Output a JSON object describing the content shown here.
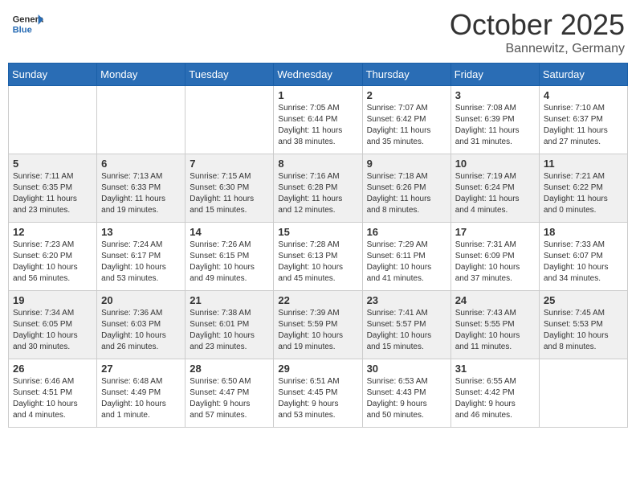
{
  "header": {
    "logo_general": "General",
    "logo_blue": "Blue",
    "month": "October 2025",
    "location": "Bannewitz, Germany"
  },
  "days_of_week": [
    "Sunday",
    "Monday",
    "Tuesday",
    "Wednesday",
    "Thursday",
    "Friday",
    "Saturday"
  ],
  "weeks": [
    [
      {
        "day": "",
        "detail": ""
      },
      {
        "day": "",
        "detail": ""
      },
      {
        "day": "",
        "detail": ""
      },
      {
        "day": "1",
        "detail": "Sunrise: 7:05 AM\nSunset: 6:44 PM\nDaylight: 11 hours\nand 38 minutes."
      },
      {
        "day": "2",
        "detail": "Sunrise: 7:07 AM\nSunset: 6:42 PM\nDaylight: 11 hours\nand 35 minutes."
      },
      {
        "day": "3",
        "detail": "Sunrise: 7:08 AM\nSunset: 6:39 PM\nDaylight: 11 hours\nand 31 minutes."
      },
      {
        "day": "4",
        "detail": "Sunrise: 7:10 AM\nSunset: 6:37 PM\nDaylight: 11 hours\nand 27 minutes."
      }
    ],
    [
      {
        "day": "5",
        "detail": "Sunrise: 7:11 AM\nSunset: 6:35 PM\nDaylight: 11 hours\nand 23 minutes."
      },
      {
        "day": "6",
        "detail": "Sunrise: 7:13 AM\nSunset: 6:33 PM\nDaylight: 11 hours\nand 19 minutes."
      },
      {
        "day": "7",
        "detail": "Sunrise: 7:15 AM\nSunset: 6:30 PM\nDaylight: 11 hours\nand 15 minutes."
      },
      {
        "day": "8",
        "detail": "Sunrise: 7:16 AM\nSunset: 6:28 PM\nDaylight: 11 hours\nand 12 minutes."
      },
      {
        "day": "9",
        "detail": "Sunrise: 7:18 AM\nSunset: 6:26 PM\nDaylight: 11 hours\nand 8 minutes."
      },
      {
        "day": "10",
        "detail": "Sunrise: 7:19 AM\nSunset: 6:24 PM\nDaylight: 11 hours\nand 4 minutes."
      },
      {
        "day": "11",
        "detail": "Sunrise: 7:21 AM\nSunset: 6:22 PM\nDaylight: 11 hours\nand 0 minutes."
      }
    ],
    [
      {
        "day": "12",
        "detail": "Sunrise: 7:23 AM\nSunset: 6:20 PM\nDaylight: 10 hours\nand 56 minutes."
      },
      {
        "day": "13",
        "detail": "Sunrise: 7:24 AM\nSunset: 6:17 PM\nDaylight: 10 hours\nand 53 minutes."
      },
      {
        "day": "14",
        "detail": "Sunrise: 7:26 AM\nSunset: 6:15 PM\nDaylight: 10 hours\nand 49 minutes."
      },
      {
        "day": "15",
        "detail": "Sunrise: 7:28 AM\nSunset: 6:13 PM\nDaylight: 10 hours\nand 45 minutes."
      },
      {
        "day": "16",
        "detail": "Sunrise: 7:29 AM\nSunset: 6:11 PM\nDaylight: 10 hours\nand 41 minutes."
      },
      {
        "day": "17",
        "detail": "Sunrise: 7:31 AM\nSunset: 6:09 PM\nDaylight: 10 hours\nand 37 minutes."
      },
      {
        "day": "18",
        "detail": "Sunrise: 7:33 AM\nSunset: 6:07 PM\nDaylight: 10 hours\nand 34 minutes."
      }
    ],
    [
      {
        "day": "19",
        "detail": "Sunrise: 7:34 AM\nSunset: 6:05 PM\nDaylight: 10 hours\nand 30 minutes."
      },
      {
        "day": "20",
        "detail": "Sunrise: 7:36 AM\nSunset: 6:03 PM\nDaylight: 10 hours\nand 26 minutes."
      },
      {
        "day": "21",
        "detail": "Sunrise: 7:38 AM\nSunset: 6:01 PM\nDaylight: 10 hours\nand 23 minutes."
      },
      {
        "day": "22",
        "detail": "Sunrise: 7:39 AM\nSunset: 5:59 PM\nDaylight: 10 hours\nand 19 minutes."
      },
      {
        "day": "23",
        "detail": "Sunrise: 7:41 AM\nSunset: 5:57 PM\nDaylight: 10 hours\nand 15 minutes."
      },
      {
        "day": "24",
        "detail": "Sunrise: 7:43 AM\nSunset: 5:55 PM\nDaylight: 10 hours\nand 11 minutes."
      },
      {
        "day": "25",
        "detail": "Sunrise: 7:45 AM\nSunset: 5:53 PM\nDaylight: 10 hours\nand 8 minutes."
      }
    ],
    [
      {
        "day": "26",
        "detail": "Sunrise: 6:46 AM\nSunset: 4:51 PM\nDaylight: 10 hours\nand 4 minutes."
      },
      {
        "day": "27",
        "detail": "Sunrise: 6:48 AM\nSunset: 4:49 PM\nDaylight: 10 hours\nand 1 minute."
      },
      {
        "day": "28",
        "detail": "Sunrise: 6:50 AM\nSunset: 4:47 PM\nDaylight: 9 hours\nand 57 minutes."
      },
      {
        "day": "29",
        "detail": "Sunrise: 6:51 AM\nSunset: 4:45 PM\nDaylight: 9 hours\nand 53 minutes."
      },
      {
        "day": "30",
        "detail": "Sunrise: 6:53 AM\nSunset: 4:43 PM\nDaylight: 9 hours\nand 50 minutes."
      },
      {
        "day": "31",
        "detail": "Sunrise: 6:55 AM\nSunset: 4:42 PM\nDaylight: 9 hours\nand 46 minutes."
      },
      {
        "day": "",
        "detail": ""
      }
    ]
  ]
}
